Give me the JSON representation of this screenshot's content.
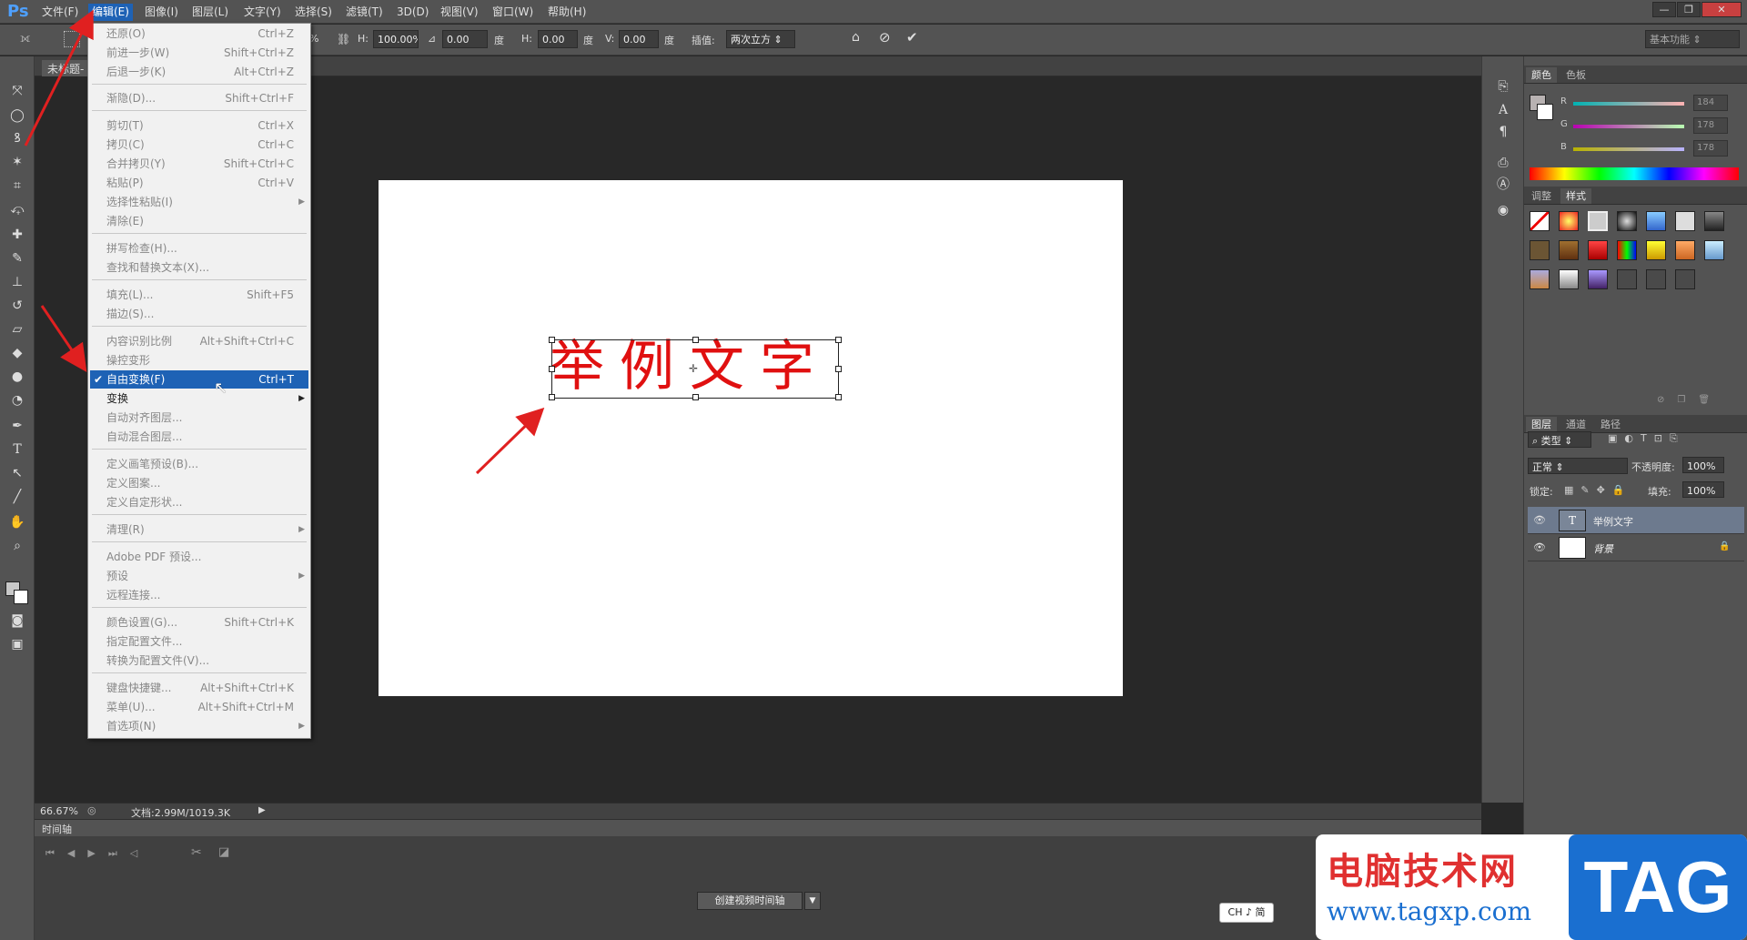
{
  "app": {
    "logo": "Ps"
  },
  "menubar": {
    "items": [
      "文件(F)",
      "编辑(E)",
      "图像(I)",
      "图层(L)",
      "文字(Y)",
      "选择(S)",
      "滤镜(T)",
      "3D(D)",
      "视图(V)",
      "窗口(W)",
      "帮助(H)"
    ],
    "active": "编辑(E)"
  },
  "options": {
    "h_pct_label": "H:",
    "h_pct_value": "100.00%",
    "angle_value": "0.00",
    "deg1": "度",
    "h_skew_label": "H:",
    "h_skew_value": "0.00",
    "deg2": "度",
    "v_skew_label": "V:",
    "v_skew_value": "0.00",
    "deg3": "度",
    "interp_label": "插值:",
    "interp_value": "两次立方",
    "partial_pct": "%",
    "workspace": "基本功能"
  },
  "document": {
    "tab_label": "未标题-",
    "canvas_text": "举例文字",
    "zoom": "66.67%",
    "doc_info": "文档:2.99M/1019.3K"
  },
  "edit_menu": [
    {
      "label": "还原(O)",
      "shortcut": "Ctrl+Z"
    },
    {
      "label": "前进一步(W)",
      "shortcut": "Shift+Ctrl+Z"
    },
    {
      "label": "后退一步(K)",
      "shortcut": "Alt+Ctrl+Z"
    },
    {
      "label": "渐隐(D)...",
      "shortcut": "Shift+Ctrl+F"
    },
    {
      "label": "剪切(T)",
      "shortcut": "Ctrl+X"
    },
    {
      "label": "拷贝(C)",
      "shortcut": "Ctrl+C"
    },
    {
      "label": "合并拷贝(Y)",
      "shortcut": "Shift+Ctrl+C"
    },
    {
      "label": "粘贴(P)",
      "shortcut": "Ctrl+V"
    },
    {
      "label": "选择性粘贴(I)",
      "shortcut": ""
    },
    {
      "label": "清除(E)",
      "shortcut": ""
    },
    {
      "label": "拼写检查(H)...",
      "shortcut": ""
    },
    {
      "label": "查找和替换文本(X)...",
      "shortcut": ""
    },
    {
      "label": "填充(L)...",
      "shortcut": "Shift+F5"
    },
    {
      "label": "描边(S)...",
      "shortcut": ""
    },
    {
      "label": "内容识别比例",
      "shortcut": "Alt+Shift+Ctrl+C"
    },
    {
      "label": "操控变形",
      "shortcut": ""
    },
    {
      "label": "自由变换(F)",
      "shortcut": "Ctrl+T"
    },
    {
      "label": "变换",
      "shortcut": ""
    },
    {
      "label": "自动对齐图层...",
      "shortcut": ""
    },
    {
      "label": "自动混合图层...",
      "shortcut": ""
    },
    {
      "label": "定义画笔预设(B)...",
      "shortcut": ""
    },
    {
      "label": "定义图案...",
      "shortcut": ""
    },
    {
      "label": "定义自定形状...",
      "shortcut": ""
    },
    {
      "label": "清理(R)",
      "shortcut": ""
    },
    {
      "label": "Adobe PDF 预设...",
      "shortcut": ""
    },
    {
      "label": "预设",
      "shortcut": ""
    },
    {
      "label": "远程连接...",
      "shortcut": ""
    },
    {
      "label": "颜色设置(G)...",
      "shortcut": "Shift+Ctrl+K"
    },
    {
      "label": "指定配置文件...",
      "shortcut": ""
    },
    {
      "label": "转换为配置文件(V)...",
      "shortcut": ""
    },
    {
      "label": "键盘快捷键...",
      "shortcut": "Alt+Shift+Ctrl+K"
    },
    {
      "label": "菜单(U)...",
      "shortcut": "Alt+Shift+Ctrl+M"
    },
    {
      "label": "首选项(N)",
      "shortcut": ""
    }
  ],
  "color_panel": {
    "tabs": [
      "颜色",
      "色板"
    ],
    "r_label": "R",
    "r_value": "184",
    "g_label": "G",
    "g_value": "178",
    "b_label": "B",
    "b_value": "178"
  },
  "styles_panel": {
    "tabs": [
      "调整",
      "样式"
    ]
  },
  "layers_panel": {
    "tabs": [
      "图层",
      "通道",
      "路径"
    ],
    "filter": "类型",
    "blend_mode": "正常",
    "opacity_label": "不透明度:",
    "opacity_value": "100%",
    "lock_label": "锁定:",
    "fill_label": "填充:",
    "fill_value": "100%",
    "layers": [
      {
        "name": "举例文字",
        "thumb": "T",
        "selected": true
      },
      {
        "name": "背景",
        "thumb": "",
        "selected": false
      }
    ]
  },
  "timeline": {
    "title": "时间轴",
    "create_button": "创建视频时间轴"
  },
  "ime": "CH ♪ 简",
  "watermark": {
    "cn": "电脑技术网",
    "url": "www.tagxp.com",
    "tag": "TAG"
  },
  "colors": {
    "highlight": "#1e62b5",
    "canvas_text": "#e01010",
    "arrow": "#e02020"
  }
}
